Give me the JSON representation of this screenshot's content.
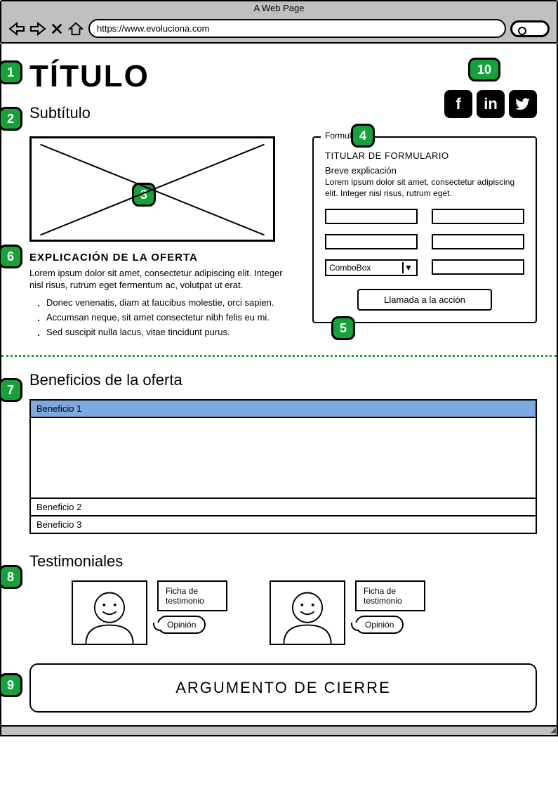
{
  "browser": {
    "tab_title": "A Web Page",
    "url": "https://www.evoluciona.com"
  },
  "badges": {
    "n1": "1",
    "n2": "2",
    "n3": "3",
    "n4": "4",
    "n5": "5",
    "n6": "6",
    "n7": "7",
    "n8": "8",
    "n9": "9",
    "n10": "10"
  },
  "header": {
    "title": "TÍTULO",
    "subtitle": "Subtítulo"
  },
  "social": {
    "facebook": "f",
    "linkedin": "in",
    "twitter": "t"
  },
  "offer": {
    "heading": "EXPLICACIÓN DE LA OFERTA",
    "text": "Lorem ipsum dolor sit amet, consectetur adipiscing elit. Integer nisl risus, rutrum eget fermentum ac, volutpat ut erat.",
    "bullets": [
      "Donec venenatis, diam at faucibus molestie, orci sapien.",
      "Accumsan neque, sit amet consectetur nibh felis eu mi.",
      "Sed suscipit nulla lacus, vitae tincidunt purus."
    ]
  },
  "form": {
    "legend": "Formulario",
    "title": "TITULAR DE FORMULARIO",
    "subtitle": "Breve explicación",
    "text": "Lorem ipsum dolor sit amet, consectetur adipiscing elit. Integer nisl risus, rutrum eget.",
    "combo_label": "ComboBox",
    "cta": "Llamada a la acción"
  },
  "benefits": {
    "heading": "Beneficios de la oferta",
    "items": [
      "Beneficio 1",
      "Beneficio 2",
      "Beneficio 3"
    ]
  },
  "testimonials": {
    "heading": "Testimoniales",
    "ficha": "Ficha de testimonio",
    "opinion": "Opinión"
  },
  "closing": {
    "text": "ARGUMENTO DE CIERRE"
  }
}
